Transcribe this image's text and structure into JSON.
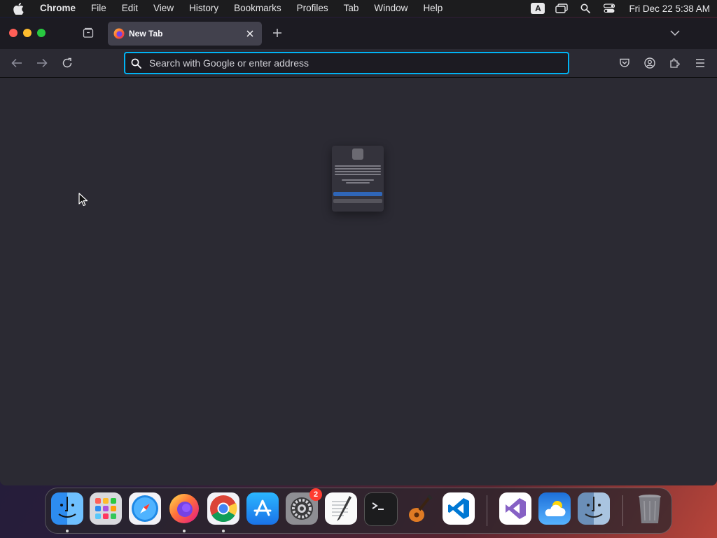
{
  "menubar": {
    "app_name": "Chrome",
    "items": [
      "File",
      "Edit",
      "View",
      "History",
      "Bookmarks",
      "Profiles",
      "Tab",
      "Window",
      "Help"
    ],
    "input_badge": "A",
    "clock": "Fri Dec 22  5:38 AM"
  },
  "browser": {
    "tab_title": "New Tab",
    "address_placeholder": "Search with Google or enter address",
    "address_value": ""
  },
  "dock": {
    "apps": [
      "finder-icon",
      "launchpad-icon",
      "safari-icon",
      "firefox-icon",
      "chrome-icon",
      "app-store-icon",
      "system-settings-icon",
      "textedit-icon",
      "terminal-icon",
      "garageband-icon",
      "vscode-icon",
      "visual-studio-icon",
      "weather-icon",
      "finder-alt-icon",
      "trash-icon"
    ],
    "settings_badge": "2"
  },
  "colors": {
    "accent_focus": "#00b3f4",
    "window_bg": "#2b2a33",
    "tab_bg": "#42414d",
    "badge_red": "#ff3b30"
  }
}
